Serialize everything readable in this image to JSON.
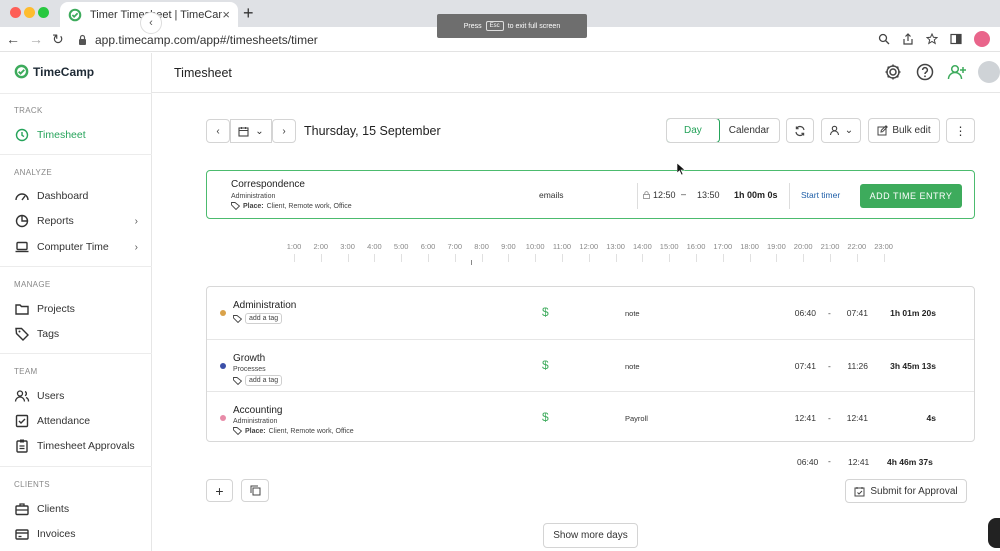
{
  "browser": {
    "tab_title": "Timer Timesheet | TimeCamp",
    "tab_close": "×",
    "new_tab": "+",
    "fullscreen_press": "Press",
    "fullscreen_key": "Esc",
    "fullscreen_suffix": "to exit full screen",
    "url": "app.timecamp.com/app#/timesheets/timer",
    "nav_back": "←",
    "nav_forward": "→",
    "nav_reload": "↻"
  },
  "sidebar": {
    "logo": "TimeCamp",
    "collapse": "‹",
    "sections": {
      "track": "TRACK",
      "analyze": "ANALYZE",
      "manage": "MANAGE",
      "team": "TEAM",
      "clients": "CLIENTS"
    },
    "items": {
      "timesheet": "Timesheet",
      "dashboard": "Dashboard",
      "reports": "Reports",
      "computer_time": "Computer Time",
      "projects": "Projects",
      "tags": "Tags",
      "users": "Users",
      "attendance": "Attendance",
      "timesheet_approvals": "Timesheet Approvals",
      "clients": "Clients",
      "invoices": "Invoices"
    },
    "chevron": "›"
  },
  "header": {
    "title": "Timesheet"
  },
  "toolbar": {
    "prev": "‹",
    "next": "›",
    "date": "Thursday, 15 September",
    "view_day": "Day",
    "view_calendar": "Calendar",
    "bulk_edit": "Bulk edit",
    "more": "⋮",
    "calendar_chevron": "⌄",
    "user_chevron": "⌄"
  },
  "timer": {
    "task": "Correspondence",
    "project": "Administration",
    "place_label": "Place:",
    "place_value": "Client, Remote work, Office",
    "note": "emails",
    "start": "12:50",
    "dash": "–",
    "end": "13:50",
    "duration": "1h 00m 0s",
    "start_timer": "Start timer",
    "add_entry": "ADD TIME ENTRY"
  },
  "timeline": {
    "hours": [
      "1:00",
      "2:00",
      "3:00",
      "4:00",
      "5:00",
      "6:00",
      "7:00",
      "8:00",
      "9:00",
      "10:00",
      "11:00",
      "12:00",
      "13:00",
      "14:00",
      "15:00",
      "16:00",
      "17:00",
      "18:00",
      "19:00",
      "20:00",
      "21:00",
      "22:00",
      "23:00"
    ]
  },
  "entries": [
    {
      "task": "Administration",
      "project": "",
      "tag_label": "",
      "tag_value": "add a tag",
      "tag_is_pill": true,
      "dot_color": "#d9a24a",
      "billable": "$",
      "note": "note",
      "start": "06:40",
      "dash": "-",
      "end": "07:41",
      "duration": "1h 01m 20s"
    },
    {
      "task": "Growth",
      "project": "Processes",
      "tag_label": "",
      "tag_value": "add a tag",
      "tag_is_pill": true,
      "dot_color": "#3b4fa8",
      "billable": "$",
      "note": "note",
      "start": "07:41",
      "dash": "-",
      "end": "11:26",
      "duration": "3h 45m 13s"
    },
    {
      "task": "Accounting",
      "project": "Administration",
      "tag_label": "Place:",
      "tag_value": "Client, Remote work, Office",
      "tag_is_pill": false,
      "dot_color": "#e88ba8",
      "billable": "$",
      "note": "Payroll",
      "start": "12:41",
      "dash": "-",
      "end": "12:41",
      "duration": "4s"
    }
  ],
  "totals": {
    "start": "06:40",
    "dash": "-",
    "end": "12:41",
    "duration": "4h 46m 37s"
  },
  "footer": {
    "add": "+",
    "submit": "Submit for Approval",
    "show_more": "Show more days"
  },
  "colors": {
    "brand_green": "#3dab5c",
    "link_blue": "#1f5fa8"
  }
}
